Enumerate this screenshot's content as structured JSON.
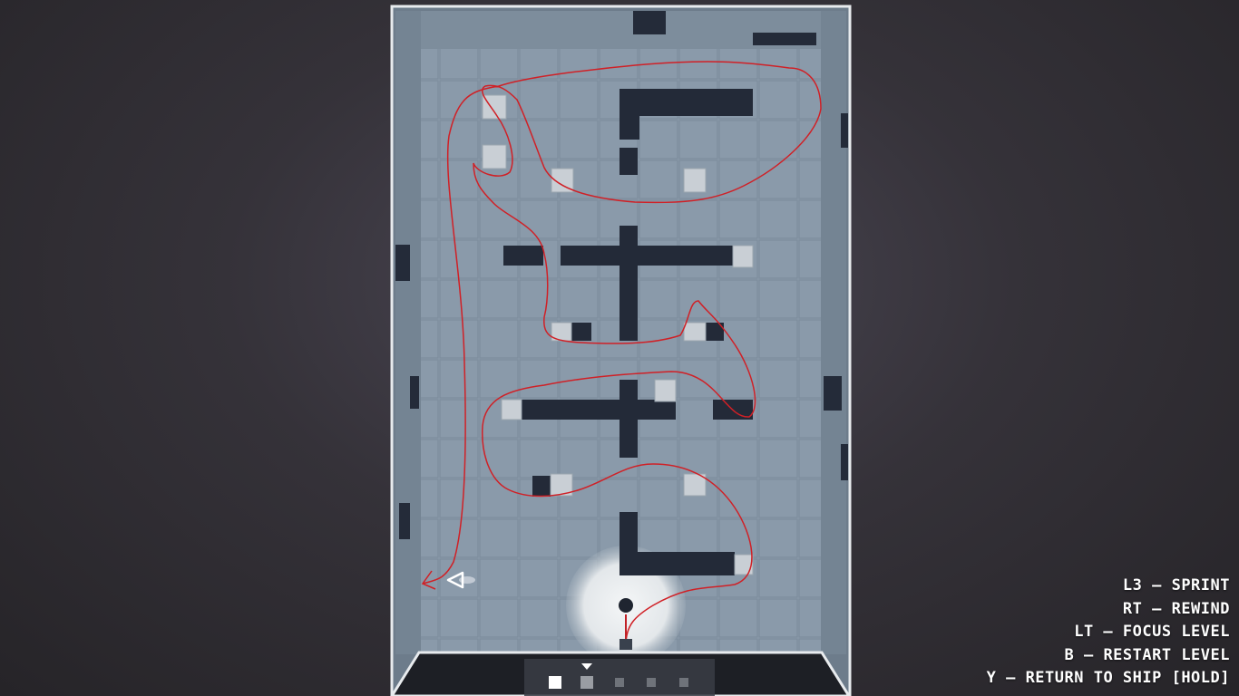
{
  "controls": [
    {
      "key": "L3",
      "action": "SPRINT"
    },
    {
      "key": "RT",
      "action": "REWIND"
    },
    {
      "key": "LT",
      "action": "FOCUS LEVEL"
    },
    {
      "key": "B",
      "action": "RESTART LEVEL"
    },
    {
      "key": "Y",
      "action": "RETURN TO SHIP [HOLD]"
    }
  ],
  "level_selector": {
    "current_index": 0,
    "total_slots": 5,
    "slot_states": [
      "active",
      "unlocked",
      "locked",
      "locked",
      "locked"
    ]
  },
  "icons": {
    "player": "triangle-cursor-icon",
    "selector": "triangle-down-icon"
  },
  "colors": {
    "path": "#d02026",
    "floor": "#8596a6",
    "wall": "#232a38",
    "crate": "#c9cfd5",
    "room_border": "#e8ebee"
  }
}
